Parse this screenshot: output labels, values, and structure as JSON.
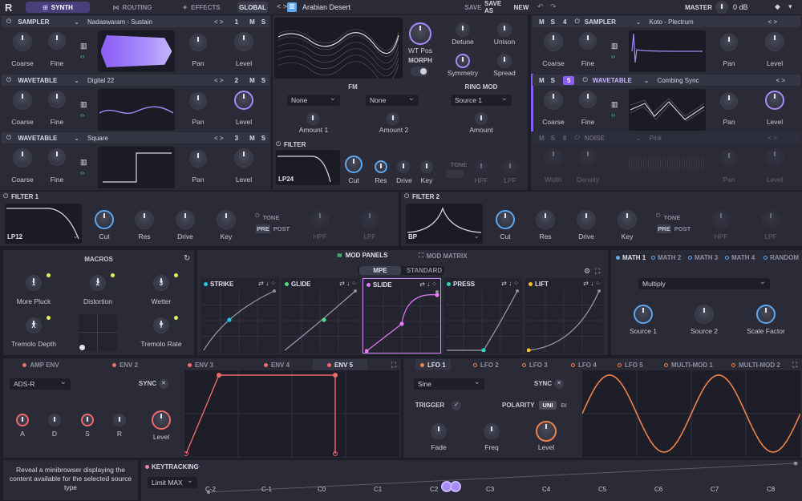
{
  "topbar": {
    "logo": "R",
    "tabs": [
      {
        "label": "SYNTH"
      },
      {
        "label": "ROUTING"
      },
      {
        "label": "EFFECTS"
      },
      {
        "label": "GLOBAL"
      }
    ],
    "preset_name": "Arabian Desert",
    "save": "SAVE",
    "save_as": "SAVE AS",
    "new": "NEW",
    "master_label": "MASTER",
    "master_value": "0 dB"
  },
  "sources": [
    {
      "type": "SAMPLER",
      "name": "Nadaswaram - Sustain",
      "index": "1",
      "m": "M",
      "s": "S",
      "knobs": [
        "Coarse",
        "Fine",
        "Pan",
        "Level"
      ]
    },
    {
      "type": "WAVETABLE",
      "name": "Digital 22",
      "index": "2",
      "m": "M",
      "s": "S",
      "knobs": [
        "Coarse",
        "Fine",
        "Pan",
        "Level"
      ]
    },
    {
      "type": "WAVETABLE",
      "name": "Square",
      "index": "3",
      "m": "M",
      "s": "S",
      "knobs": [
        "Coarse",
        "Fine",
        "Pan",
        "Level"
      ]
    },
    {
      "type": "SAMPLER",
      "name": "Koto - Plectrum",
      "index": "4",
      "m": "M",
      "s": "S",
      "knobs": [
        "Coarse",
        "Fine",
        "Pan",
        "Level"
      ]
    },
    {
      "type": "WAVETABLE",
      "name": "Combing Sync",
      "index": "5",
      "m": "M",
      "s": "S",
      "knobs": [
        "Coarse",
        "Fine",
        "Pan",
        "Level"
      ]
    },
    {
      "type": "NOISE",
      "name": "Pink",
      "index": "6",
      "m": "M",
      "s": "S",
      "knobs": [
        "Width",
        "Density",
        "Pan",
        "Level"
      ]
    }
  ],
  "center": {
    "wt_pos": "WT Pos",
    "morph": "MORPH",
    "detune": "Detune",
    "unison": "Unison",
    "symmetry": "Symmetry",
    "spread": "Spread",
    "fm_title": "FM",
    "fm1": "None",
    "fm2": "None",
    "amount1": "Amount 1",
    "amount2": "Amount 2",
    "ring_title": "RING MOD",
    "ring_src": "Source 1",
    "ring_amount": "Amount",
    "filter_title": "FILTER",
    "filter_type": "LP24",
    "cut": "Cut",
    "res": "Res",
    "drive": "Drive",
    "key": "Key",
    "tone": "TONE",
    "hpf": "HPF",
    "lpf": "LPF"
  },
  "filters": [
    {
      "title": "FILTER 1",
      "type": "LP12",
      "cut": "Cut",
      "res": "Res",
      "drive": "Drive",
      "key": "Key",
      "tone": "TONE",
      "pre": "PRE",
      "post": "POST",
      "hpf": "HPF",
      "lpf": "LPF"
    },
    {
      "title": "FILTER 2",
      "type": "BP",
      "cut": "Cut",
      "res": "Res",
      "drive": "Drive",
      "key": "Key",
      "tone": "TONE",
      "pre": "PRE",
      "post": "POST",
      "hpf": "HPF",
      "lpf": "LPF"
    }
  ],
  "macros": {
    "title": "MACROS",
    "items": [
      {
        "num": "1",
        "label": "More Pluck"
      },
      {
        "num": "2",
        "label": "Distortion"
      },
      {
        "num": "3",
        "label": "Wetter"
      },
      {
        "num": "X",
        "label": "Tremolo Depth"
      },
      {
        "num": "Y",
        "label": "Tremolo Rate"
      }
    ]
  },
  "modpanels": {
    "tab1": "MOD PANELS",
    "tab2": "MOD MATRIX",
    "mpe": "MPE",
    "standard": "STANDARD",
    "curves": [
      {
        "name": "STRIKE",
        "color": "#22c6e6"
      },
      {
        "name": "GLIDE",
        "color": "#4ade80"
      },
      {
        "name": "SLIDE",
        "color": "#e879f9"
      },
      {
        "name": "PRESS",
        "color": "#2dd4bf"
      },
      {
        "name": "LIFT",
        "color": "#fbbf24"
      }
    ]
  },
  "math": {
    "tabs": [
      "MATH 1",
      "MATH 2",
      "MATH 3",
      "MATH 4",
      "RANDOM"
    ],
    "mode": "Multiply",
    "knobs": [
      "Source 1",
      "Source 2",
      "Scale Factor"
    ]
  },
  "env": {
    "tabs": [
      "AMP ENV",
      "ENV 2",
      "ENV 3",
      "ENV 4",
      "ENV 5"
    ],
    "mode": "ADS-R",
    "sync": "SYNC",
    "knobs": [
      "A",
      "D",
      "S",
      "R"
    ],
    "level": "Level"
  },
  "lfo": {
    "tabs": [
      "LFO 1",
      "LFO 2",
      "LFO 3",
      "LFO 4",
      "LFO 5",
      "MULTI-MOD 1",
      "MULTI-MOD 2"
    ],
    "shape": "Sine",
    "sync": "SYNC",
    "trigger": "TRIGGER",
    "polarity": "POLARITY",
    "uni": "UNI",
    "bi": "BI",
    "knobs": [
      "Fade",
      "Freq",
      "Level"
    ]
  },
  "footer": {
    "hint": "Reveal a minibrowser displaying the content available for the selected source type",
    "keytracking": "KEYTRACKING",
    "mode": "Limit MAX",
    "notes": [
      "C-2",
      "C-1",
      "C0",
      "C1",
      "C2",
      "C3",
      "C4",
      "C5",
      "C6",
      "C7",
      "C8"
    ]
  },
  "colors": {
    "accent": "#8b5cf6",
    "red": "#ef6b6b",
    "blue": "#5fa8f0",
    "orange": "#f0814a"
  }
}
